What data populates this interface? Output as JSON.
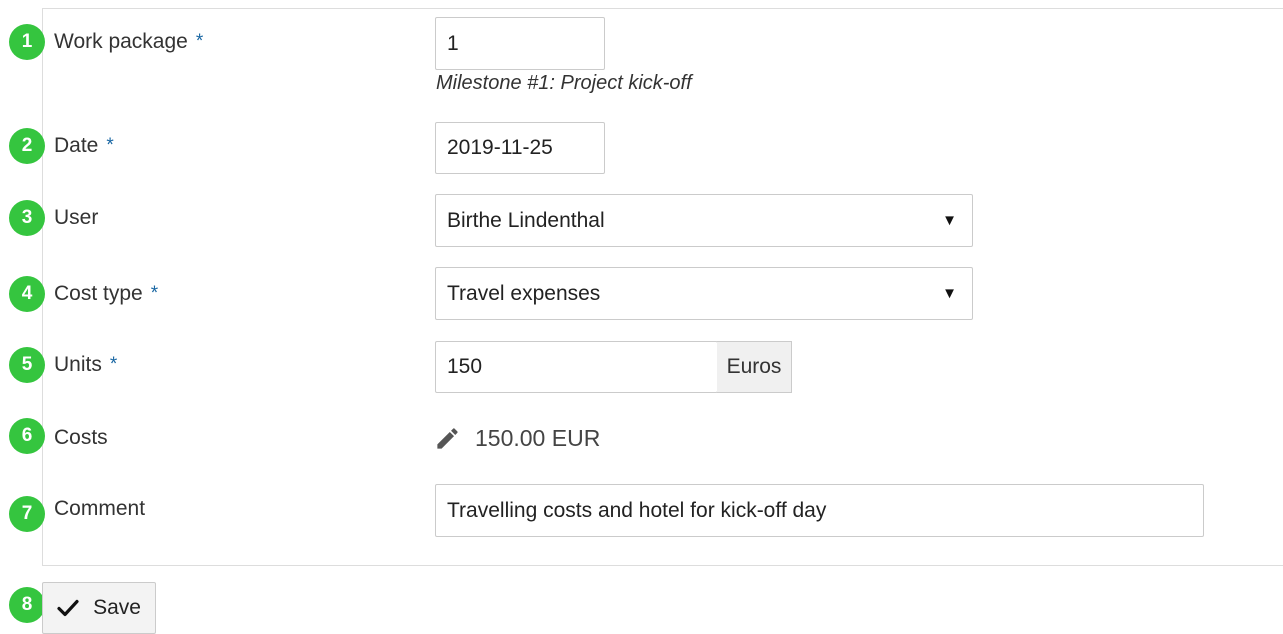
{
  "form": {
    "work_package": {
      "marker": "1",
      "label": "Work package",
      "required": "*",
      "value": "1",
      "hint": "Milestone #1: Project kick-off"
    },
    "date": {
      "marker": "2",
      "label": "Date",
      "required": "*",
      "value": "2019-11-25"
    },
    "user": {
      "marker": "3",
      "label": "User",
      "value": "Birthe Lindenthal",
      "caret": "▼"
    },
    "cost_type": {
      "marker": "4",
      "label": "Cost type",
      "required": "*",
      "value": "Travel expenses",
      "caret": "▼"
    },
    "units": {
      "marker": "5",
      "label": "Units",
      "required": "*",
      "value": "150",
      "unit": "Euros"
    },
    "costs": {
      "marker": "6",
      "label": "Costs",
      "value": "150.00 EUR",
      "icon": "pencil-icon"
    },
    "comment": {
      "marker": "7",
      "label": "Comment",
      "value": "Travelling costs and hotel for kick-off day"
    }
  },
  "actions": {
    "marker": "8",
    "save_label": "Save",
    "save_icon": "checkmark-icon"
  },
  "colors": {
    "marker_green": "#35c53f",
    "required_blue": "#1a67a3"
  }
}
